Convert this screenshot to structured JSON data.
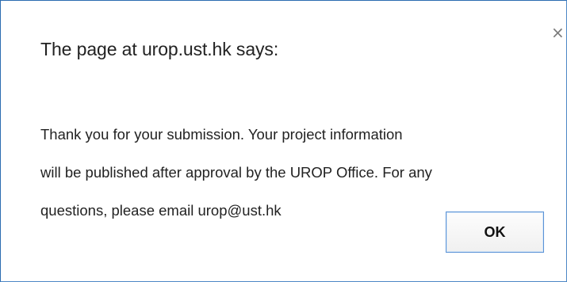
{
  "dialog": {
    "title": "The page at urop.ust.hk says:",
    "close_icon": "close-icon",
    "close_glyph": "×",
    "message_line1": "Thank you for your submission.  Your project information",
    "message_line2": "will be published after approval by the UROP Office. For any",
    "message_line3": "questions, please email urop@ust.hk",
    "ok_label": "OK"
  },
  "colors": {
    "border": "#2b6cb0",
    "button_border": "#5b93d6",
    "text": "#222222"
  }
}
